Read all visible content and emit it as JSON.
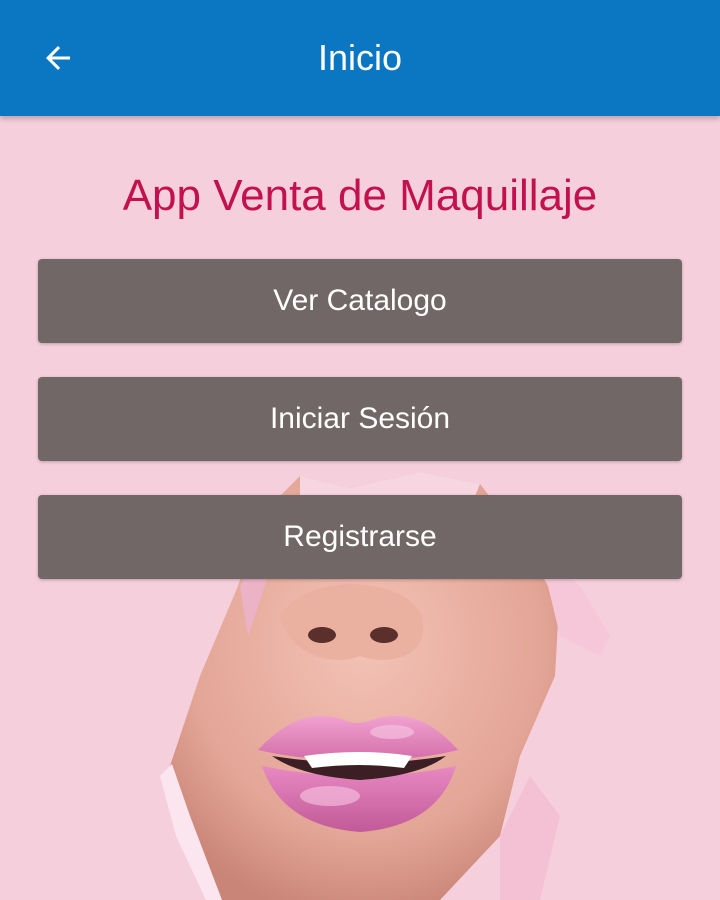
{
  "appbar": {
    "title": "Inicio",
    "back_icon": "arrow-back-icon",
    "color": "#0b77c3"
  },
  "main": {
    "title": "App Venta de Maquillaje",
    "title_color": "#c2114e",
    "buttons": [
      {
        "label": "Ver Catalogo"
      },
      {
        "label": "Iniciar Sesión"
      },
      {
        "label": "Registrarse"
      }
    ],
    "button_color": "#716766",
    "background_color": "#f6cfdc"
  }
}
